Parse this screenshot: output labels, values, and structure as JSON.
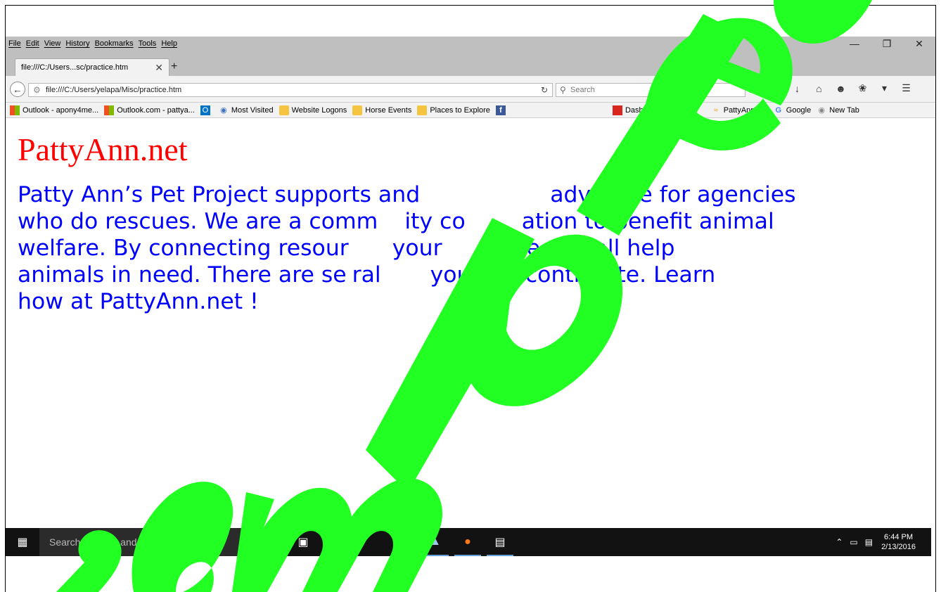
{
  "browser": {
    "menu": [
      "File",
      "Edit",
      "View",
      "History",
      "Bookmarks",
      "Tools",
      "Help"
    ],
    "window_controls": {
      "minimize": "—",
      "restore": "❐",
      "close": "✕"
    },
    "tab": {
      "title": "file:///C:/Users...sc/practice.htm",
      "close": "✕"
    },
    "new_tab": "+",
    "url": "file:///C:/Users/yelapa/Misc/practice.htm",
    "search_placeholder": "Search",
    "bookmarks": [
      {
        "label": "Outlook - apony4me...",
        "icon": "microsoft-icon"
      },
      {
        "label": "Outlook.com - pattya...",
        "icon": "microsoft-icon"
      },
      {
        "label": "",
        "icon": "outlook-icon"
      },
      {
        "label": "Most Visited",
        "icon": "most-visited-icon"
      },
      {
        "label": "Website Logons",
        "icon": "folder-icon"
      },
      {
        "label": "Horse Events",
        "icon": "folder-icon"
      },
      {
        "label": "Places to Explore",
        "icon": "folder-icon"
      },
      {
        "label": "",
        "icon": "facebook-icon"
      },
      {
        "label": "Dashboard",
        "icon": "dashboard-icon"
      },
      {
        "label": "PattyAnn.net",
        "icon": "rss-icon"
      },
      {
        "label": "Google",
        "icon": "google-icon"
      },
      {
        "label": "New Tab",
        "icon": "newtab-icon"
      }
    ]
  },
  "page": {
    "title": "PattyAnn.net",
    "intro_line1": "Patty Ann’s Pet Project supports and",
    "intro_line1b": "advocate for agencies",
    "intro_line2": "who do rescues. We are a comm",
    "intro_line2b": "ity co",
    "intro_line2c": "ation to benefit animal",
    "intro_line3": "welfare. By connecting resour",
    "intro_line3b": "your",
    "intro_line3c": "e can all help",
    "intro_line4": "animals in need. There are se",
    "intro_line4b": "ral",
    "intro_line4c": "you c",
    "intro_line4d": "n contribute. Learn",
    "intro_line5": "how at PattyAnn.net !"
  },
  "taskbar": {
    "search_placeholder": "Search the web and Windows",
    "time": "6:44 PM",
    "date": "2/13/2016"
  },
  "colors": {
    "title": "#ff0000",
    "intro": "#0000ff",
    "watermark": "#22ff22"
  }
}
